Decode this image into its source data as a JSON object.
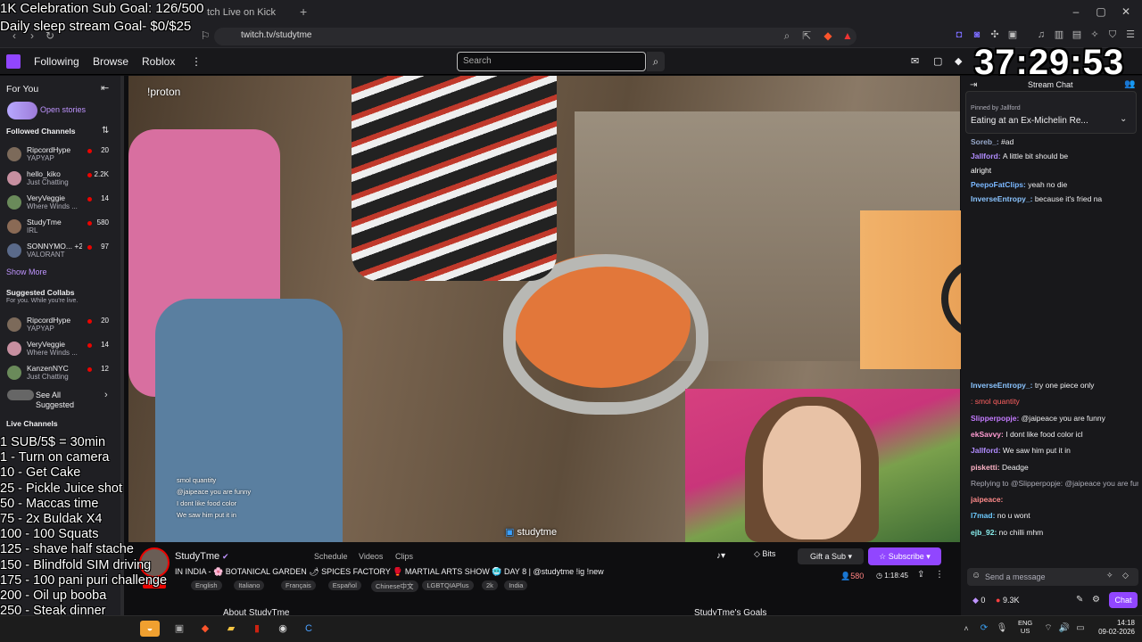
{
  "browser": {
    "tab_title": "tch Live on Kick",
    "url": "twitch.tv/studytme"
  },
  "overlay": {
    "goal_line1": "1K Celebration Sub Goal: 126/500",
    "goal_line2": "Daily sleep stream Goal- $0/$25",
    "timer": "37:29:53",
    "proton": "!proton",
    "watermark": "studytme",
    "goals": [
      "1 SUB/5$ = 30min",
      "1 - Turn on camera",
      "10 - Get Cake",
      "25 - Pickle Juice shot",
      "50 - Maccas time",
      "75 - 2x Buldak X4",
      "100 - 100 Squats",
      "125 - shave half stache",
      "150 - Blindfold SIM driving",
      "175 - 100 pani puri challenge",
      "200 - Oil up booba",
      "250 - Steak dinner",
      "500 - Baldge"
    ],
    "video_chat": [
      "smol quantity",
      "@jaipeace you are funny",
      "I dont like food color",
      "We saw him put it in"
    ]
  },
  "nav": {
    "following": "Following",
    "browse": "Browse",
    "roblox": "Roblox",
    "search_placeholder": "Search"
  },
  "sidebar": {
    "for_you": "For You",
    "open_stories": "Open stories",
    "followed_header": "Followed Channels",
    "followed": [
      {
        "name": "RipcordHype",
        "sub": "YAPYAP",
        "count": "20"
      },
      {
        "name": "hello_kiko",
        "sub": "Just Chatting",
        "count": "2.2K"
      },
      {
        "name": "VeryVeggie",
        "sub": "Where Winds ...",
        "count": "14"
      },
      {
        "name": "StudyTme",
        "sub": "IRL",
        "count": "580"
      },
      {
        "name": "SONNYMO... +2",
        "sub": "VALORANT",
        "count": "97"
      }
    ],
    "show_more": "Show More",
    "suggested_header": "Suggested Collabs",
    "suggested_sub": "For you. While you're live.",
    "suggested": [
      {
        "name": "RipcordHype",
        "sub": "YAPYAP",
        "count": "20"
      },
      {
        "name": "VeryVeggie",
        "sub": "Where Winds ...",
        "count": "14"
      },
      {
        "name": "KanzenNYC",
        "sub": "Just Chatting",
        "count": "12"
      }
    ],
    "see_all": "See All",
    "suggested_word": "Suggested",
    "live_header": "Live Channels"
  },
  "info": {
    "channel": "StudyTme",
    "schedule": "Schedule",
    "videos": "Videos",
    "clips": "Clips",
    "title": "IN INDIA - 🌸 BOTANICAL GARDEN 🌶 SPICES FACTORY 🥊 MARTIAL ARTS SHOW 🥶 DAY 8 | @studytme !ig !new",
    "tags": [
      "English",
      "Italiano",
      "Français",
      "Español",
      "Chinese中文",
      "LGBTQIAPlus",
      "2k",
      "India"
    ],
    "bits": "Bits",
    "gift": "Gift a Sub",
    "subscribe": "Subscribe",
    "viewers": "580",
    "uptime": "1:18:45",
    "about": "About StudyTme",
    "goals_title": "StudyTme's Goals"
  },
  "chat": {
    "header": "Stream Chat",
    "pinned_by": "Pinned by Jallford",
    "pinned_text": "Eating at an Ex-Michelin Re...",
    "messages_top": [
      {
        "user": "Soreb_:",
        "text": "#ad",
        "color": "#9ac"
      },
      {
        "user": "Jallford:",
        "text": "A little bit should be",
        "color": "#b18cff"
      },
      {
        "user": "",
        "text": "alright",
        "color": "#fff"
      },
      {
        "user": "PeepoFatClips:",
        "text": "yeah no die",
        "color": "#7ab7ff"
      },
      {
        "user": "InverseEntropy_:",
        "text": "because it's fried na",
        "color": "#8ac4ff"
      }
    ],
    "messages_bottom": [
      {
        "user": "InverseEntropy_:",
        "text": "try one piece only",
        "color": "#8ac4ff"
      },
      {
        "user": "",
        "text": ": smol quantity",
        "color": "#ff6060"
      },
      {
        "user": "Slipperpopje:",
        "text": "@jaipeace you are funny",
        "color": "#c47bff"
      },
      {
        "user": "ekSavvy:",
        "text": "I dont like food color icl",
        "color": "#ff9bd2"
      },
      {
        "user": "Jallford:",
        "text": "We saw him put it in",
        "color": "#b18cff"
      },
      {
        "user": "pisketti:",
        "text": "Deadge",
        "color": "#ffb3c6"
      },
      {
        "user": "",
        "text": "Replying to @Slipperpopje: @jaipeace you are fur",
        "color": "#adadb8"
      },
      {
        "user": "jaipeace:",
        "text": "",
        "color": "#ff8a8a"
      },
      {
        "user": "l7mad:",
        "text": "no u wont",
        "color": "#6ccaff"
      },
      {
        "user": "ejb_92:",
        "text": "no chilli mhm",
        "color": "#8ee"
      }
    ],
    "input_placeholder": "Send a message",
    "points": "0",
    "bits_count": "9.3K",
    "chat_button": "Chat"
  },
  "taskbar": {
    "lang1": "ENG",
    "lang2": "US",
    "time": "14:18",
    "date": "09-02-2026"
  },
  "colors": {
    "twitch_purple": "#9146ff",
    "live_red": "#eb0400"
  }
}
